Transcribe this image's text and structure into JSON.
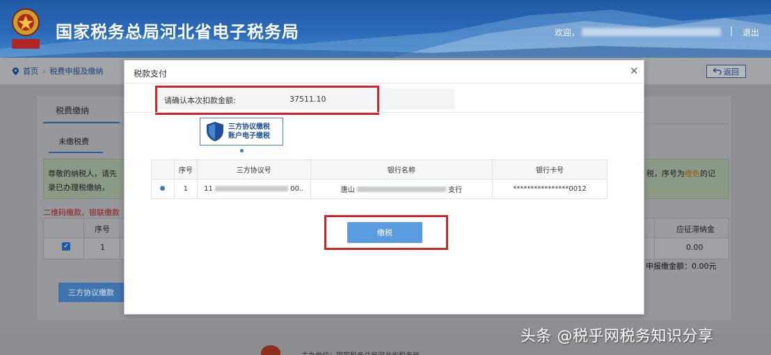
{
  "header": {
    "site_title": "国家税务总局河北省电子税务局",
    "welcome": "欢迎，",
    "divider": "|",
    "logout": "退出"
  },
  "breadcrumb": {
    "home": "首页",
    "separator": "›",
    "current": "税费申报及缴纳"
  },
  "back_button": "返回",
  "background": {
    "tab_primary": "税费缴纳",
    "tab_secondary": "未缴税费",
    "notice_line1": "尊敬的纳税人，请先",
    "notice_line2": "录已办理税缴纳，",
    "notice_right_pre": "税，序号为",
    "notice_right_highlight": "橙色",
    "notice_right_post": "的记",
    "red_note": "二维码缴款、银联缴款",
    "th_no": "序号",
    "th_right": "应征滞纳金",
    "td_no": "1",
    "td_right": "0.00",
    "sum_text": "申报缴金额：0.00元",
    "pay_button": "三方协议缴款",
    "footer_text": "主办单位：国家税务总局河北省税务局"
  },
  "modal": {
    "title": "税款支付",
    "close_icon": "close-icon",
    "amount_label": "请确认本次扣款金额:",
    "amount_value": "37511.10",
    "agreement_line1": "三方协议缴税",
    "agreement_line2": "账户电子缴税",
    "table": {
      "headers": [
        "",
        "序号",
        "三方协议号",
        "银行名称",
        "银行卡号"
      ],
      "rows": [
        {
          "no": "1",
          "agreement_prefix": "11",
          "agreement_suffix": "00..",
          "bank_prefix": "唐山",
          "bank_suffix": "支行",
          "card_number": "****************0012"
        }
      ]
    },
    "pay_button": "缴税"
  },
  "watermark": "头条 @税乎网税务知识分享",
  "colors": {
    "header_blue": "#2a6ab8",
    "highlight_red": "#d2222a",
    "button_blue": "#5b9be0"
  }
}
